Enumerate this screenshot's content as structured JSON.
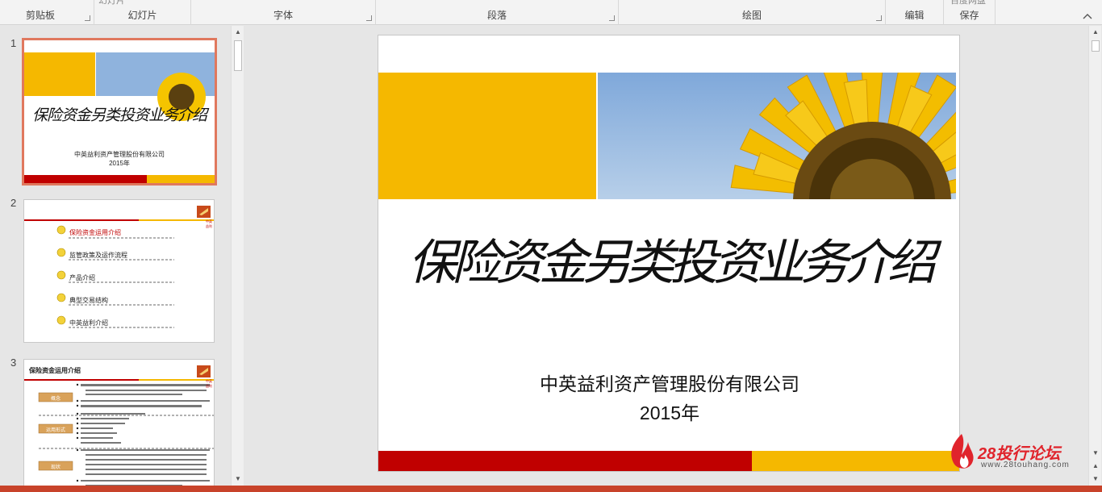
{
  "ribbon": {
    "groups": [
      {
        "label": "剪贴板"
      },
      {
        "label": "幻灯片"
      },
      {
        "label": "字体"
      },
      {
        "label": "段落"
      },
      {
        "label": "绘图"
      },
      {
        "label": "编辑"
      },
      {
        "label": "保存"
      }
    ],
    "cut_top_texts": [
      "幻灯片",
      "百度网盘"
    ]
  },
  "thumbnails": [
    {
      "number": "1",
      "title": "保险资金另类投资业务介绍",
      "company": "中英益利资产管理股份有限公司",
      "year": "2015年"
    },
    {
      "number": "2",
      "items": [
        "保险资金运用介绍",
        "监管政策及运作流程",
        "产品介绍",
        "典型交易结构",
        "中英益利介绍"
      ],
      "logo_text": "中英益利"
    },
    {
      "number": "3",
      "title": "保险资金运用介绍",
      "labels": [
        "概念",
        "运用形式",
        "现状"
      ],
      "logo_text": "中英益利"
    }
  ],
  "slide": {
    "title": "保险资金另类投资业务介绍",
    "company": "中英益利资产管理股份有限公司",
    "year": "2015年"
  },
  "watermark": {
    "brand": "28投行论坛",
    "url": "www.28touhang.com"
  },
  "colors": {
    "accent_orange": "#f5b800",
    "accent_red": "#c00000",
    "status_bar": "#c8432a",
    "selection": "#e0785e"
  }
}
